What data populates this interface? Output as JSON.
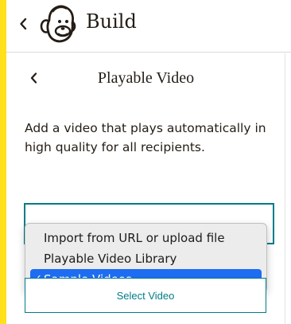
{
  "header": {
    "title": "Build",
    "back_icon": "chevron-left-icon",
    "logo_icon": "mailchimp-freddie-logo"
  },
  "panel": {
    "back_icon": "chevron-left-icon",
    "title": "Playable Video",
    "description": "Add a video that plays automatically in high quality for all recipients."
  },
  "video_source_dropdown": {
    "options": [
      "Import from URL or upload file",
      "Playable Video Library",
      "Sample Videos"
    ],
    "selected_index": 2,
    "check_mark": "✓"
  },
  "select_button": {
    "label": "Select Video"
  },
  "colors": {
    "accent_yellow": "#ffe01b",
    "teal": "#007c89",
    "selection_blue": "#1e6cf1"
  }
}
